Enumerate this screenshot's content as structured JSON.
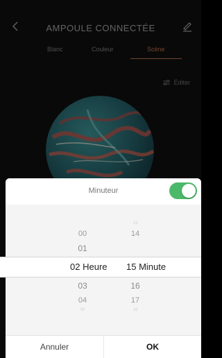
{
  "header": {
    "title": "AMPOULE CONNECTÉE"
  },
  "tabs": [
    {
      "label": "Blanc"
    },
    {
      "label": "Couleur"
    },
    {
      "label": "Scène"
    }
  ],
  "scene": {
    "edit_label": "Éditer"
  },
  "sheet": {
    "title": "Minuteur",
    "toggle_on": true,
    "hours": {
      "above": [
        "00",
        "01"
      ],
      "selected": "02",
      "below": [
        "03",
        "04",
        "05"
      ],
      "unit": "Heure"
    },
    "minutes": {
      "above": [
        "13",
        "14"
      ],
      "selected": "15",
      "below": [
        "16",
        "17",
        "18"
      ],
      "unit": "Minute"
    },
    "cancel_label": "Annuler",
    "ok_label": "OK"
  },
  "colors": {
    "accent": "#b06a4a",
    "toggle": "#4cb96a"
  }
}
